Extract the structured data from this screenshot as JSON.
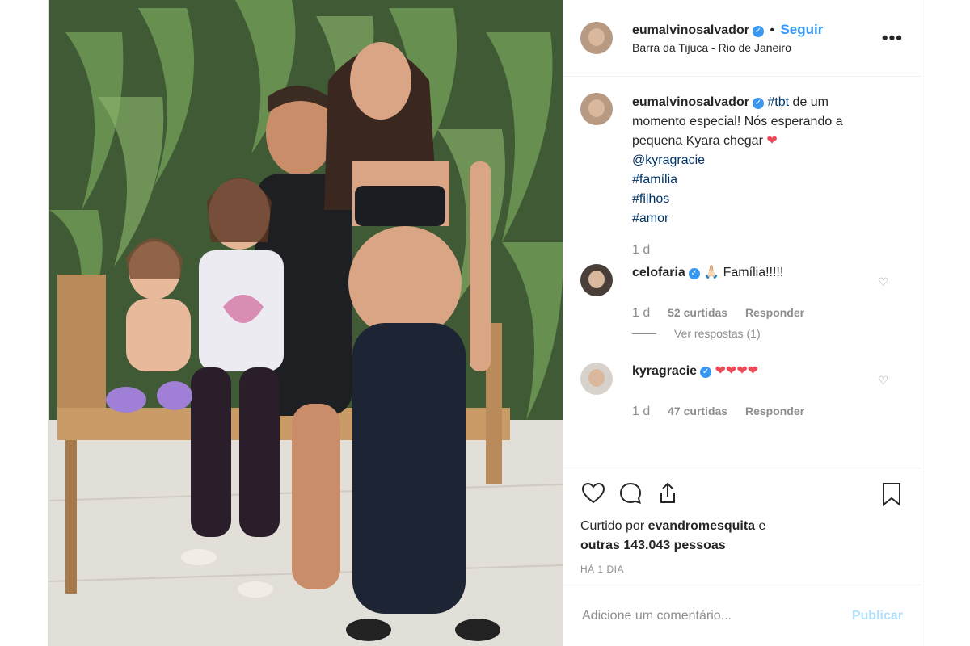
{
  "post": {
    "author": "eumalvinosalvador",
    "follow_label": "Seguir",
    "separator": "•",
    "location": "Barra da Tijuca - Rio de Janeiro",
    "more_icon": "more-horizontal-icon",
    "caption": {
      "author": "eumalvinosalvador",
      "hashtag_tbt": "#tbt",
      "text": " de um momento especial! Nós esperando a pequena Kyara chegar ",
      "heart": "❤",
      "mention": "@kyragracie",
      "tags": [
        "#família",
        "#filhos",
        "#amor"
      ],
      "time": "1 d"
    },
    "comments": [
      {
        "author": "celofaria",
        "text": "🙏🏻 Família!!!!!",
        "time": "1 d",
        "likes": "52 curtidas",
        "reply": "Responder",
        "view_replies": "Ver respostas (1)"
      },
      {
        "author": "kyragracie",
        "text": "❤❤❤❤",
        "time": "1 d",
        "likes": "47 curtidas",
        "reply": "Responder"
      }
    ],
    "liked_by_prefix": "Curtido por ",
    "liked_by_user": "evandromesquita",
    "liked_by_connector": " e",
    "liked_by_others": "outras 143.043 pessoas",
    "posted_ago": "HÁ 1 DIA",
    "add_comment_placeholder": "Adicione um comentário...",
    "publish_label": "Publicar"
  },
  "colors": {
    "accent": "#3897f0",
    "muted": "#8e8e8e",
    "heart": "#ed4956",
    "publish_disabled": "#b2dffc"
  }
}
